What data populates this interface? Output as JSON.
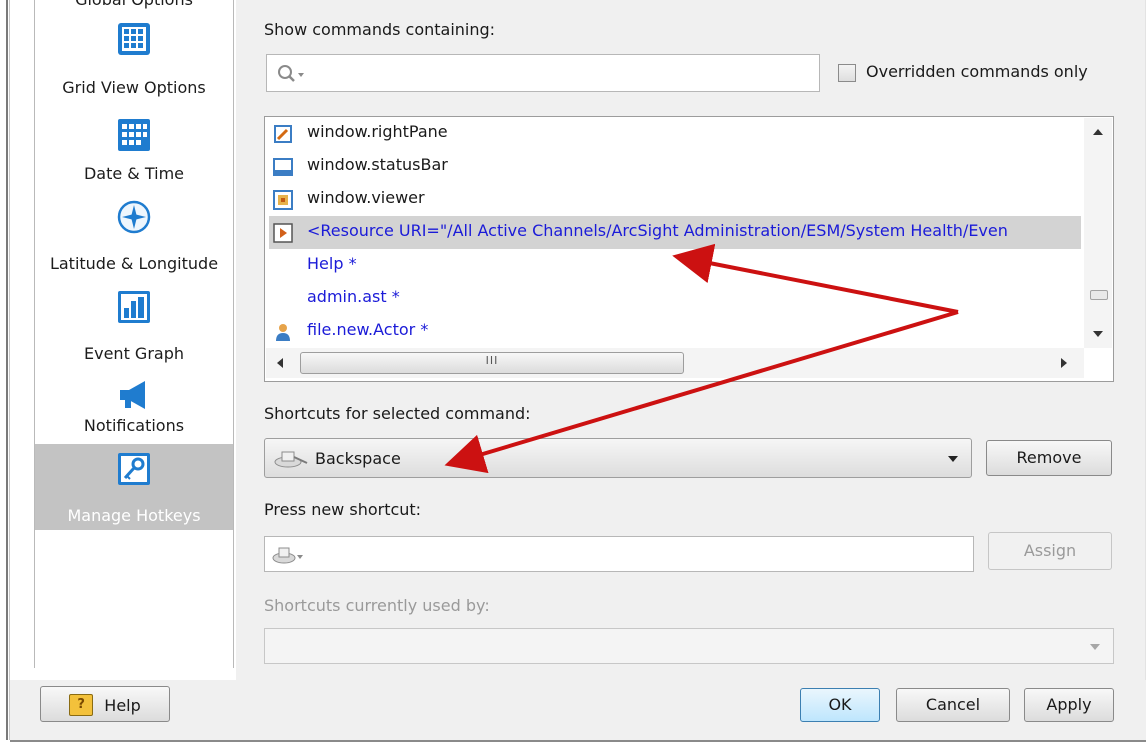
{
  "sidebar": {
    "items": [
      {
        "label": "Global Options",
        "icon": "global-options-icon"
      },
      {
        "label": "Grid View Options",
        "icon": "grid-icon"
      },
      {
        "label": "Date & Time",
        "icon": "calendar-icon"
      },
      {
        "label": "Latitude & Longitude",
        "icon": "compass-icon"
      },
      {
        "label": "Event Graph",
        "icon": "bar-chart-icon"
      },
      {
        "label": "Notifications",
        "icon": "megaphone-icon"
      },
      {
        "label": "Manage Hotkeys",
        "icon": "key-icon",
        "selected": true
      }
    ]
  },
  "main": {
    "show_commands_label": "Show commands containing:",
    "search_placeholder": "",
    "overridden_label": "Overridden commands only",
    "commands": [
      {
        "text": "window.rightPane",
        "icon": "edit-pane-icon",
        "color": "#1a1a1a"
      },
      {
        "text": "window.statusBar",
        "icon": "statusbar-icon",
        "color": "#1a1a1a"
      },
      {
        "text": "window.viewer",
        "icon": "viewer-icon",
        "color": "#1a1a1a"
      },
      {
        "text": "<Resource URI=\"/All Active Channels/ArcSight Administration/ESM/System Health/Even",
        "icon": "play-icon",
        "color": "#1b1bd8",
        "selected": true
      },
      {
        "text": "Help *",
        "icon": "",
        "color": "#1b1bd8"
      },
      {
        "text": "admin.ast *",
        "icon": "",
        "color": "#1b1bd8"
      },
      {
        "text": "file.new.Actor *",
        "icon": "actor-icon",
        "color": "#1b1bd8"
      }
    ],
    "hscroll_grip": "III",
    "shortcuts_label": "Shortcuts for selected command:",
    "shortcut_value": "Backspace",
    "remove_label": "Remove",
    "press_new_label": "Press new shortcut:",
    "assign_label": "Assign",
    "used_by_label": "Shortcuts currently used by:"
  },
  "footer": {
    "help_label": "Help",
    "ok_label": "OK",
    "cancel_label": "Cancel",
    "apply_label": "Apply"
  },
  "colors": {
    "accent_blue": "#1b6fc7",
    "link_blue": "#1b1bd8",
    "arrow_red": "#cc1111",
    "selected_sidebar": "#c3c3c3"
  }
}
